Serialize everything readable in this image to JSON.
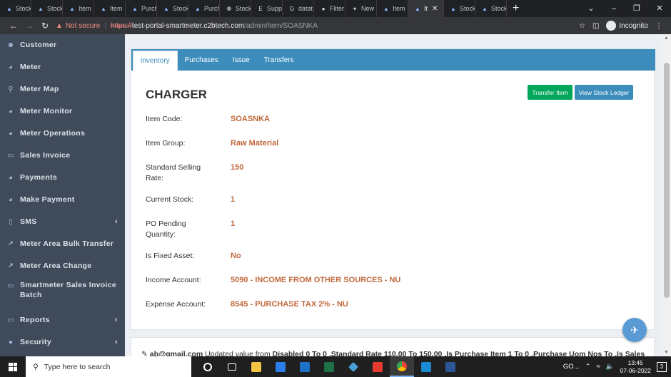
{
  "browser": {
    "tabs": [
      {
        "label": "Stock",
        "icon": "droplet-icon"
      },
      {
        "label": "Stock",
        "icon": "droplet-icon"
      },
      {
        "label": "Item",
        "icon": "droplet-icon"
      },
      {
        "label": "Item",
        "icon": "droplet-icon"
      },
      {
        "label": "Purch",
        "icon": "droplet-icon"
      },
      {
        "label": "Stock",
        "icon": "droplet-icon"
      },
      {
        "label": "Purch",
        "icon": "droplet-icon"
      },
      {
        "label": "Stock",
        "icon": "gear-icon"
      },
      {
        "label": "Supp",
        "icon": "e-icon"
      },
      {
        "label": "datat",
        "icon": "google-icon"
      },
      {
        "label": "Filter",
        "icon": "circle-icon"
      },
      {
        "label": "New",
        "icon": "star-icon"
      },
      {
        "label": "Item",
        "icon": "droplet-icon"
      },
      {
        "label": "It",
        "icon": "droplet-icon",
        "active": true
      },
      {
        "label": "Stock",
        "icon": "droplet-icon"
      },
      {
        "label": "Stock",
        "icon": "droplet-icon"
      }
    ],
    "new_tab": "+",
    "not_secure": "Not secure",
    "url_scheme": "https://",
    "url_host": "test-portal-smartmeter.c2btech.com",
    "url_path": "/admin/item/SOASNKA",
    "incognito": "Incognito"
  },
  "sidebar": {
    "items": [
      {
        "label": "Customer",
        "icon": "user-icon",
        "has_caret": false
      },
      {
        "label": "Meter",
        "icon": "dashboard-icon",
        "has_caret": false
      },
      {
        "label": "Meter Map",
        "icon": "map-marker-icon",
        "has_caret": false
      },
      {
        "label": "Meter Monitor",
        "icon": "dashboard-icon",
        "has_caret": false
      },
      {
        "label": "Meter Operations",
        "icon": "dashboard-icon",
        "has_caret": false
      },
      {
        "label": "Sales Invoice",
        "icon": "file-icon",
        "has_caret": false
      },
      {
        "label": "Payments",
        "icon": "dashboard-icon",
        "has_caret": false
      },
      {
        "label": "Make Payment",
        "icon": "dashboard-icon",
        "has_caret": false
      },
      {
        "label": "SMS",
        "icon": "mobile-icon",
        "has_caret": true
      },
      {
        "label": "Meter Area Bulk Transfer",
        "icon": "external-link-icon",
        "has_caret": false
      },
      {
        "label": "Meter Area Change",
        "icon": "external-link-icon",
        "has_caret": false
      },
      {
        "label": "Smartmeter Sales Invoice Batch",
        "icon": "file-icon",
        "has_caret": false
      },
      {
        "label": "Reports",
        "icon": "file-icon",
        "has_caret": true
      },
      {
        "label": "Security",
        "icon": "lock-icon",
        "has_caret": true
      }
    ]
  },
  "page_tabs": [
    {
      "label": "inventory",
      "active": true
    },
    {
      "label": "Purchases",
      "active": false
    },
    {
      "label": "Issue",
      "active": false
    },
    {
      "label": "Transfers",
      "active": false
    }
  ],
  "item": {
    "title": "CHARGER",
    "transfer_button": "Transfer Item",
    "ledger_button": "View Stock Ledger",
    "fields": [
      {
        "label": "Item Code:",
        "value": "SOASNKA"
      },
      {
        "label": "Item Group:",
        "value": "Raw Material"
      },
      {
        "label": "Standard Selling Rate:",
        "value": "150"
      },
      {
        "label": "Current Stock:",
        "value": "1"
      },
      {
        "label": "PO Pending Quantity:",
        "value": "1"
      },
      {
        "label": "Is Fixed Asset:",
        "value": "No"
      },
      {
        "label": "Income Account:",
        "value": "5090 - INCOME FROM OTHER SOURCES - NU"
      },
      {
        "label": "Expense Account:",
        "value": "8545 - PURCHASE TAX 2% - NU"
      }
    ]
  },
  "log": {
    "user": "ab@gmail.com",
    "action": "Updated value from",
    "details": "Disabled 0 To 0 ,Standard Rate 110.00 To 150.00 ,Is Purchase Item 1 To 0 ,Purchase Uom Nos To ,Is Sales"
  },
  "taskbar": {
    "search_placeholder": "Type here to search",
    "weather": "GO...",
    "time": "13:45",
    "date": "07-06-2022",
    "notifications": "3"
  },
  "colors": {
    "sidebar_bg": "#3f4a5a",
    "tab_bar": "#3c8dbc",
    "value_text": "#c0673a",
    "transfer_button": "#00a65a",
    "ledger_button": "#3c8dbc"
  }
}
